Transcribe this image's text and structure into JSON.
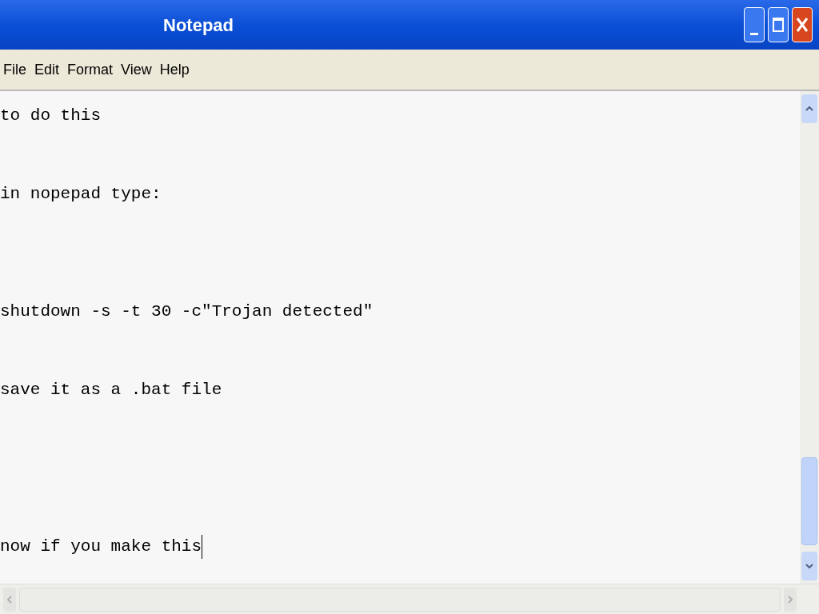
{
  "window": {
    "title": "Notepad"
  },
  "menu": [
    "File",
    "Edit",
    "Format",
    "View",
    "Help"
  ],
  "document": {
    "caret": true,
    "lines": [
      {
        "kind": "text",
        "text": "to do this"
      },
      {
        "kind": "blank"
      },
      {
        "kind": "text",
        "text": "in nopepad type:"
      },
      {
        "kind": "blank"
      },
      {
        "kind": "blank"
      },
      {
        "kind": "text",
        "text": "shutdown -s -t 30 -c\"Trojan detected\""
      },
      {
        "kind": "blank"
      },
      {
        "kind": "text",
        "text": "save it as a .bat file"
      },
      {
        "kind": "blank"
      },
      {
        "kind": "blank"
      },
      {
        "kind": "blank"
      },
      {
        "kind": "text",
        "text": "now if you make this"
      }
    ]
  }
}
